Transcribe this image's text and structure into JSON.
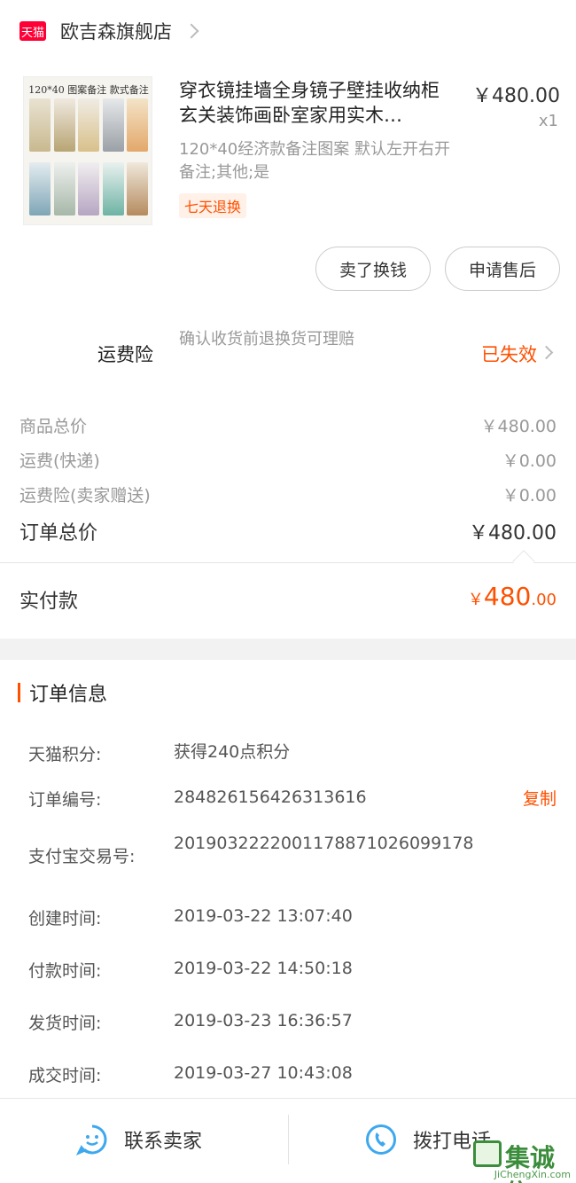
{
  "store": {
    "badge": "天猫",
    "name": "欧吉森旗舰店"
  },
  "product": {
    "thumb_title": "120*40 图案备注 款式备注",
    "title": "穿衣镜挂墙全身镜子壁挂收纳柜玄关装饰画卧室家用实木…",
    "spec": "120*40经济款备注图案 默认左开右开备注;其他;是",
    "tag": "七天退换",
    "price": "￥480.00",
    "qty": "x1"
  },
  "actions": {
    "sell_label": "卖了换钱",
    "after_sale_label": "申请售后"
  },
  "insurance": {
    "label": "运费险",
    "desc": "确认收货前退换货可理赔",
    "status": "已失效"
  },
  "fees": [
    {
      "label": "商品总价",
      "value": "￥480.00"
    },
    {
      "label": "运费(快递)",
      "value": "￥0.00"
    },
    {
      "label": "运费险(卖家赠送)",
      "value": "￥0.00"
    }
  ],
  "order_total": {
    "label": "订单总价",
    "value": "￥480.00"
  },
  "paid": {
    "label": "实付款",
    "currency": "￥",
    "integer": "480",
    "decimal": ".00"
  },
  "order_info": {
    "title": "订单信息",
    "copy_label": "复制",
    "rows": [
      {
        "label": "天猫积分:",
        "value": "获得240点积分"
      },
      {
        "label": "订单编号:",
        "value": "284826156426313616"
      },
      {
        "label": "支付宝交易号:",
        "value": "2019032222001178871026099178"
      },
      {
        "label": "创建时间:",
        "value": "2019-03-22 13:07:40"
      },
      {
        "label": "付款时间:",
        "value": "2019-03-22 14:50:18"
      },
      {
        "label": "发货时间:",
        "value": "2019-03-23 16:36:57"
      },
      {
        "label": "成交时间:",
        "value": "2019-03-27 10:43:08"
      }
    ]
  },
  "bottom": {
    "contact_label": "联系卖家",
    "call_label": "拨打电话"
  },
  "watermark": {
    "text": "集诚信",
    "sub": "JiChengXin.com"
  },
  "colors": {
    "accent": "#ff5000",
    "tmall": "#ff0036",
    "icon_blue": "#3ea8ee"
  }
}
